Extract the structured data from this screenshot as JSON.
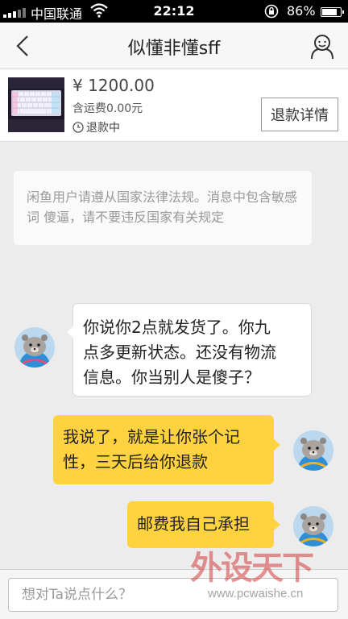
{
  "status_bar": {
    "carrier": "中国联通",
    "time": "22:12",
    "battery_percent": "86%",
    "battery_level": 0.86
  },
  "nav": {
    "title": "似懂非懂sff",
    "back_icon": "chevron-left-icon",
    "user_icon": "user-profile-icon"
  },
  "product": {
    "price": "¥ 1200.00",
    "shipping": "含运费0.00元",
    "status": "退款中",
    "refund_details_label": "退款详情"
  },
  "notice": {
    "text": "闲鱼用户请遵从国家法律法规。消息中包含敏感词 傻逼，请不要违反国家有关规定"
  },
  "messages": [
    {
      "side": "left",
      "lines": [
        "你说你2点就发货了。你九",
        "点多更新状态。还没有物流",
        "信息。你当别人是傻子？"
      ]
    },
    {
      "side": "right",
      "lines": [
        "我说了，就是让你张个记",
        "性，三天后给你退款"
      ]
    },
    {
      "side": "right",
      "lines": [
        "邮费我自己承担"
      ]
    }
  ],
  "input": {
    "placeholder": "想对Ta说点什么？"
  },
  "watermark": {
    "logo": "外设天下",
    "url": "www.pcwaishe.cn"
  },
  "colors": {
    "bubble_mine": "#ffd33f",
    "bubble_theirs": "#ffffff",
    "background": "#ececec"
  }
}
